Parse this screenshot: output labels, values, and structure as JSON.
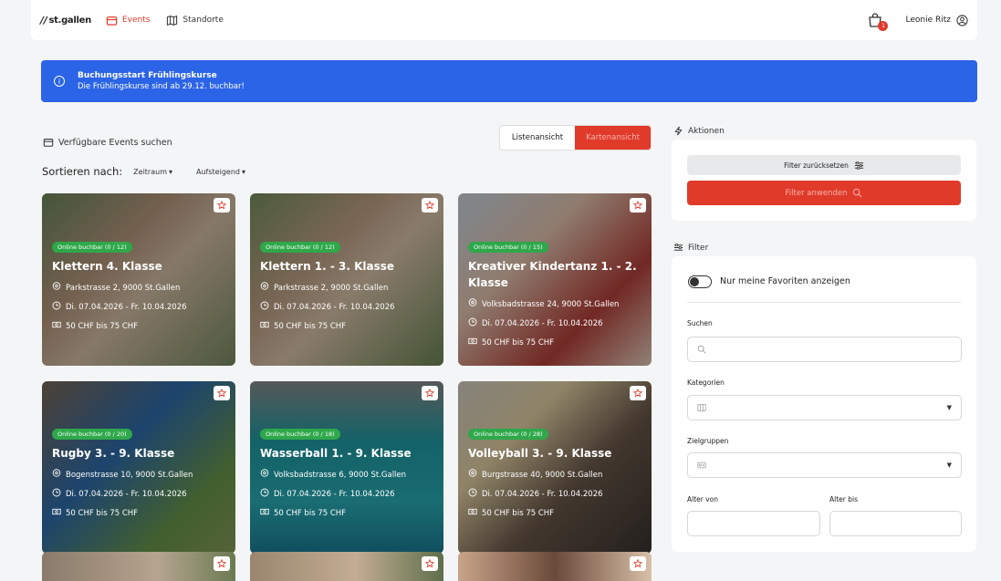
{
  "header": {
    "logo": "st.gallen",
    "nav": [
      {
        "label": "Events",
        "icon": "calendar-icon",
        "active": true
      },
      {
        "label": "Standorte",
        "icon": "map-icon",
        "active": false
      }
    ],
    "cart_count": "1",
    "user_name": "Leonie Ritz"
  },
  "banner": {
    "title": "Buchungsstart Frühlingskurse",
    "text": "Die Frühlingskurse sind ab 29.12. buchbar!"
  },
  "search": {
    "title": "Verfügbare Events suchen",
    "sort_label": "Sortieren nach:",
    "sort_field": "Zeitraum",
    "sort_order": "Aufsteigend"
  },
  "view_toggle": {
    "list": "Listenansicht",
    "map": "Kartenansicht"
  },
  "cards": [
    {
      "badge": "Online buchbar (0 / 12)",
      "title": "Klettern 4. Klasse",
      "address": "Parkstrasse 2, 9000 St.Gallen",
      "date": "Di. 07.04.2026 - Fr. 10.04.2026",
      "price": "50 CHF bis 75 CHF"
    },
    {
      "badge": "Online buchbar (0 / 12)",
      "title": "Klettern 1. - 3. Klasse",
      "address": "Parkstrasse 2, 9000 St.Gallen",
      "date": "Di. 07.04.2026 - Fr. 10.04.2026",
      "price": "50 CHF bis 75 CHF"
    },
    {
      "badge": "Online buchbar (0 / 15)",
      "title": "Kreativer Kindertanz 1. - 2. Klasse",
      "address": "Volksbadstrasse 24, 9000 St.Gallen",
      "date": "Di. 07.04.2026 - Fr. 10.04.2026",
      "price": "50 CHF bis 75 CHF"
    },
    {
      "badge": "Online buchbar (0 / 20)",
      "title": "Rugby 3. - 9. Klasse",
      "address": "Bogenstrasse 10, 9000 St.Gallen",
      "date": "Di. 07.04.2026 - Fr. 10.04.2026",
      "price": "50 CHF bis 75 CHF"
    },
    {
      "badge": "Online buchbar (0 / 18)",
      "title": "Wasserball 1. - 9. Klasse",
      "address": "Volksbadstrasse 6, 9000 St.Gallen",
      "date": "Di. 07.04.2026 - Fr. 10.04.2026",
      "price": "50 CHF bis 75 CHF"
    },
    {
      "badge": "Online buchbar (0 / 28)",
      "title": "Volleyball 3. - 9. Klasse",
      "address": "Burgstrasse 40, 9000 St.Gallen",
      "date": "Di. 07.04.2026 - Fr. 10.04.2026",
      "price": "50 CHF bis 75 CHF"
    }
  ],
  "actions": {
    "title": "Aktionen",
    "reset": "Filter zurücksetzen",
    "apply": "Filter anwenden"
  },
  "filter": {
    "title": "Filter",
    "favorites_label": "Nur meine Favoriten anzeigen",
    "search_label": "Suchen",
    "categories_label": "Kategorien",
    "targets_label": "Zielgruppen",
    "age_from_label": "Alter von",
    "age_to_label": "Alter bis"
  },
  "colors": {
    "accent": "#e03a2a",
    "banner": "#2c64e8",
    "badge": "#2ea84a"
  }
}
